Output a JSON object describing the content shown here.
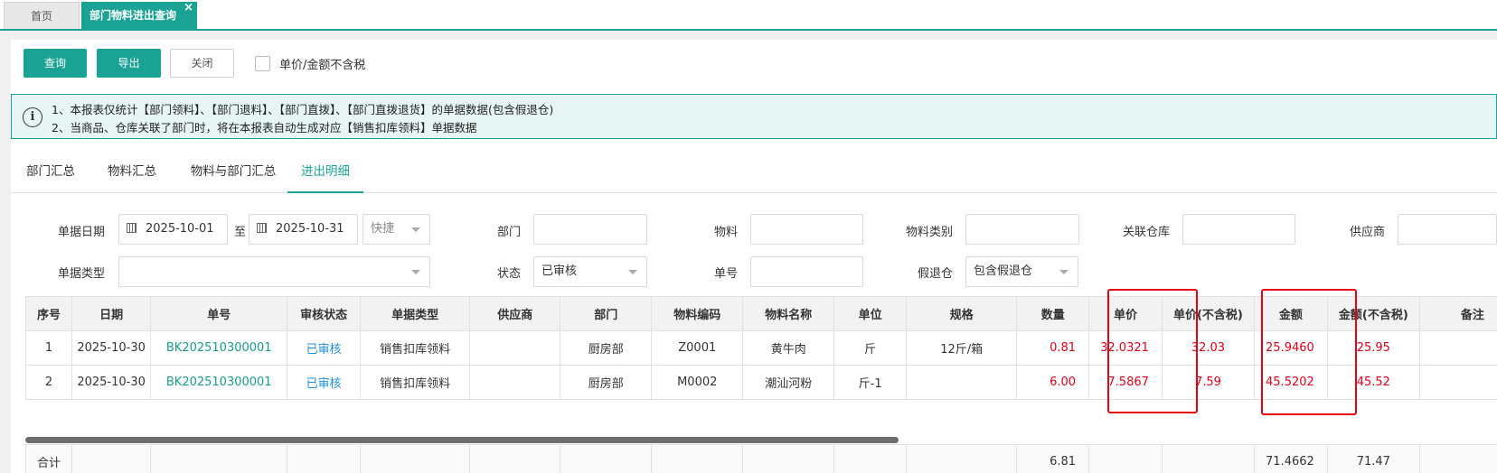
{
  "tabs": {
    "home": "首页",
    "active": "部门物料进出查询",
    "close": "×"
  },
  "toolbar": {
    "query": "查询",
    "export": "导出",
    "close": "关闭",
    "tax_checkbox": "单价/金额不含税"
  },
  "notice": {
    "icon": "i",
    "line1": "1、本报表仅统计【部门领料】、【部门退料】、【部门直拨】、【部门直拨退货】的单据数据(包含假退仓)",
    "line2": "2、当商品、仓库关联了部门时，将在本报表自动生成对应【销售扣库领料】单据数据"
  },
  "subtabs": [
    "部门汇总",
    "物料汇总",
    "物料与部门汇总",
    "进出明细"
  ],
  "filters": {
    "date_label": "单据日期",
    "date_from": "2025-10-01",
    "date_to_sep": "至",
    "date_to": "2025-10-31",
    "quick": "快捷",
    "dept_label": "部门",
    "material_label": "物料",
    "category_label": "物料类别",
    "warehouse_label": "关联仓库",
    "supplier_label": "供应商",
    "doc_type_label": "单据类型",
    "status_label": "状态",
    "status_value": "已审核",
    "doc_no_label": "单号",
    "fake_return_label": "假退仓",
    "fake_return_value": "包含假退仓"
  },
  "table": {
    "headers": [
      "序号",
      "日期",
      "单号",
      "审核状态",
      "单据类型",
      "供应商",
      "部门",
      "物料编码",
      "物料名称",
      "单位",
      "规格",
      "数量",
      "单价",
      "单价(不含税)",
      "金额",
      "金额(不含税)",
      "备注"
    ],
    "rows": [
      {
        "seq": "1",
        "date": "2025-10-30",
        "no": "BK202510300001",
        "status": "已审核",
        "type": "销售扣库领料",
        "supplier": "",
        "dept": "厨房部",
        "code": "Z0001",
        "name": "黄牛肉",
        "unit": "斤",
        "spec": "12斤/箱",
        "qty": "0.81",
        "price": "32.0321",
        "price_ex": "32.03",
        "amount": "25.9460",
        "amount_ex": "25.95",
        "remark": ""
      },
      {
        "seq": "2",
        "date": "2025-10-30",
        "no": "BK202510300001",
        "status": "已审核",
        "type": "销售扣库领料",
        "supplier": "",
        "dept": "厨房部",
        "code": "M0002",
        "name": "潮汕河粉",
        "unit": "斤-1",
        "spec": "",
        "qty": "6.00",
        "price": "7.5867",
        "price_ex": "7.59",
        "amount": "45.5202",
        "amount_ex": "45.52",
        "remark": ""
      }
    ],
    "total": {
      "label": "合计",
      "qty": "6.81",
      "amount": "71.4662",
      "amount_ex": "71.47"
    }
  },
  "colors": {
    "accent": "#1aa394",
    "highlight": "#e60012",
    "value_red": "#e0001b"
  }
}
